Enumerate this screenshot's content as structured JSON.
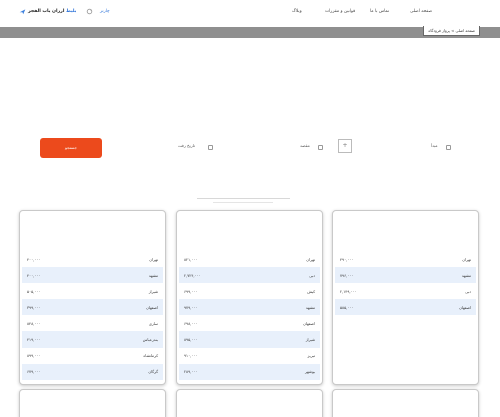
{
  "nav": {
    "links": [
      "صفحه اصلی",
      "تماس با ما",
      "قوانین و مقررات",
      "وبلاگ"
    ],
    "brand_highlight": "بلیط",
    "brand_text": "ارزان یاب الفجر",
    "brand_sub": "چارتر"
  },
  "breadcrumb": "صفحه اصلی > پرواز فرودگاه",
  "search": {
    "button_label": "جستجو",
    "from_label": "مبدأ",
    "to_label": "مقصد",
    "date_label": "تاریخ رفت",
    "plus_symbol": "+"
  },
  "cards": [
    {
      "rows": [
        {
          "city": "تهران",
          "price": "۴۹۰,۰۰۰"
        },
        {
          "city": "مشهد",
          "price": "۷۹۶,۰۰۰"
        },
        {
          "city": "دبی",
          "price": "۲,۱۴۹,۰۰۰"
        },
        {
          "city": "اصفهان",
          "price": "۵۸۵,۰۰۰"
        }
      ]
    },
    {
      "rows": [
        {
          "city": "تهران",
          "price": "۸۲۱,۰۰۰"
        },
        {
          "city": "دبی",
          "price": "۲,۷۲۴,۰۰۰"
        },
        {
          "city": "کیش",
          "price": "۶۹۹,۰۰۰"
        },
        {
          "city": "مشهد",
          "price": "۹۷۹,۰۰۰"
        },
        {
          "city": "اصفهان",
          "price": "۶۹۸,۰۰۰"
        },
        {
          "city": "شیراز",
          "price": "۸۹۵,۰۰۰"
        },
        {
          "city": "تبریز",
          "price": "۹۱۰,۰۰۰"
        },
        {
          "city": "بوشهر",
          "price": "۲۸۹,۰۰۰"
        }
      ]
    },
    {
      "rows": [
        {
          "city": "تهران",
          "price": "۴۰۰,۰۰۰"
        },
        {
          "city": "مشهد",
          "price": "۴۰۰,۰۰۰"
        },
        {
          "city": "شیراز",
          "price": "۵۰۵,۰۰۰"
        },
        {
          "city": "اصفهان",
          "price": "۳۹۹,۰۰۰"
        },
        {
          "city": "ساری",
          "price": "۸۴۸,۰۰۰"
        },
        {
          "city": "بندرعباس",
          "price": "۴۱۹,۰۰۰"
        },
        {
          "city": "کرمانشاه",
          "price": "۸۹۹,۰۰۰"
        },
        {
          "city": "گرگان",
          "price": "۶۷۹,۰۰۰"
        }
      ]
    }
  ]
}
